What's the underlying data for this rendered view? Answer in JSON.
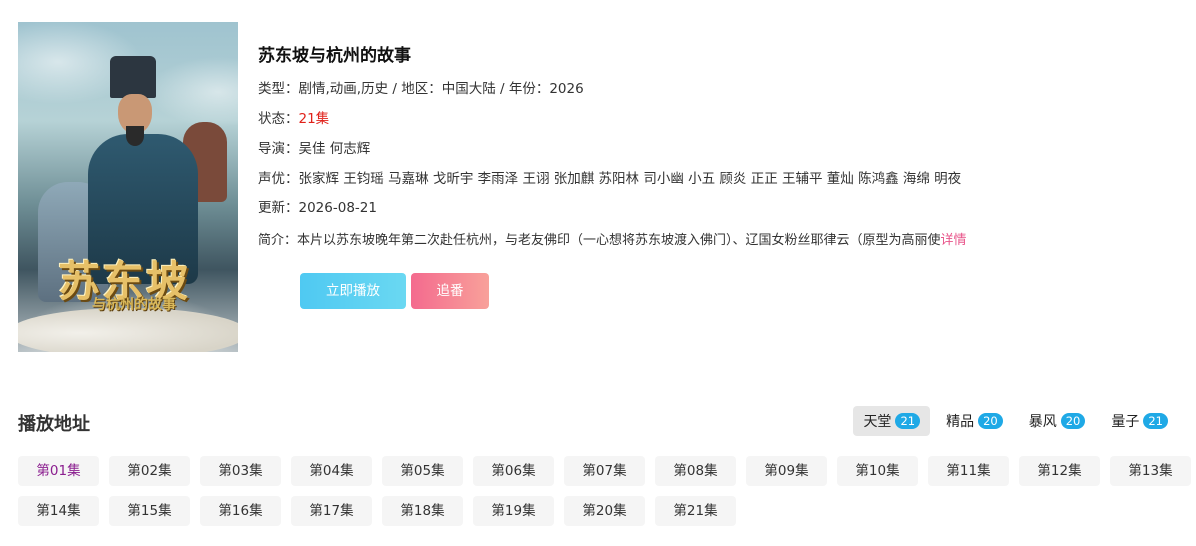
{
  "show": {
    "title": "苏东坡与杭州的故事",
    "poster_title": "苏东坡",
    "poster_subtitle": "与杭州的故事",
    "type_line": "类型：剧情,动画,历史 / 地区：中国大陆 / 年份：2026",
    "status_label": "状态：",
    "status_value": "21集",
    "director_label": "导演：",
    "directors": "吴佳 何志辉",
    "voice_label": "声优：",
    "voice_actors": "张家辉 王钧瑶 马嘉琳 戈昕宇 李雨泽 王诩 张加麒 苏阳林 司小幽 小五 顾炎 正正 王辅平 董灿 陈鸿鑫 海绵 明夜",
    "updated_label": "更新：",
    "updated_value": "2026-08-21",
    "summary_label": "简介：",
    "summary_text": "本片以苏东坡晚年第二次赴任杭州，与老友佛印（一心想将苏东坡渡入佛门）、辽国女粉丝耶律云（原型为高丽使",
    "summary_more": "详情"
  },
  "actions": {
    "play_label": "立即播放",
    "follow_label": "追番"
  },
  "playlist": {
    "title": "播放地址",
    "sources": [
      {
        "name": "天堂",
        "count": "21",
        "active": true
      },
      {
        "name": "精品",
        "count": "20",
        "active": false
      },
      {
        "name": "暴风",
        "count": "20",
        "active": false
      },
      {
        "name": "量子",
        "count": "21",
        "active": false
      }
    ],
    "episodes": [
      "第01集",
      "第02集",
      "第03集",
      "第04集",
      "第05集",
      "第06集",
      "第07集",
      "第08集",
      "第09集",
      "第10集",
      "第11集",
      "第12集",
      "第13集",
      "第14集",
      "第15集",
      "第16集",
      "第17集",
      "第18集",
      "第19集",
      "第20集",
      "第21集"
    ],
    "active_episode": "第01集"
  }
}
